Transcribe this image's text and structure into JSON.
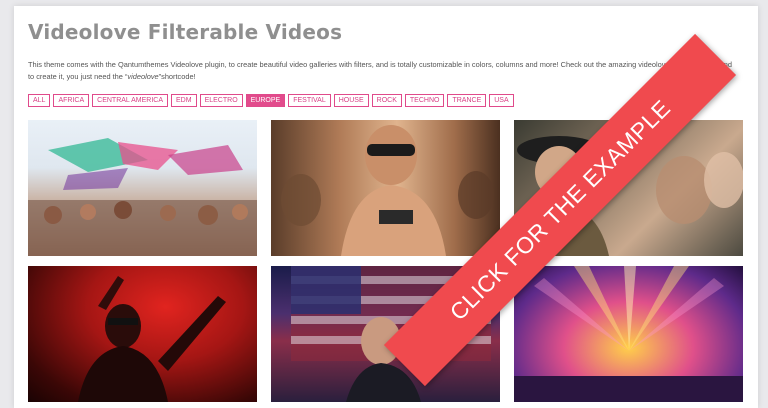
{
  "page": {
    "title": "Videolove Filterable Videos",
    "description_prefix": "This theme comes with the Qantumthemes Videolove plugin, to create beautiful video galleries with filters, and is totally customizable in colors, columns and more! Check out the amazing videolove gallery here… and to create it, you just need the “",
    "description_code": "videolove",
    "description_suffix": "”shortcode!"
  },
  "filters": [
    {
      "label": "ALL",
      "active": false
    },
    {
      "label": "AFRICA",
      "active": false
    },
    {
      "label": "CENTRAL AMERICA",
      "active": false
    },
    {
      "label": "EDM",
      "active": false
    },
    {
      "label": "ELECTRO",
      "active": false
    },
    {
      "label": "EUROPE",
      "active": true
    },
    {
      "label": "FESTIVAL",
      "active": false
    },
    {
      "label": "HOUSE",
      "active": false
    },
    {
      "label": "ROCK",
      "active": false
    },
    {
      "label": "TECHNO",
      "active": false
    },
    {
      "label": "TRANCE",
      "active": false
    },
    {
      "label": "USA",
      "active": false
    }
  ],
  "gallery": [
    {
      "scene": "festival-crowd-with-canopies"
    },
    {
      "scene": "shirtless-man-with-sunglasses"
    },
    {
      "scene": "smiling-woman-in-hat"
    },
    {
      "scene": "performer-under-red-lights"
    },
    {
      "scene": "woman-with-american-flag"
    },
    {
      "scene": "stage-light-show"
    }
  ],
  "ribbon": {
    "label": "CLICK FOR THE EXAMPLE"
  },
  "colors": {
    "accent_pink": "#e24b8c",
    "ribbon_red": "#f04a4e",
    "title_gray": "#8f8f8f"
  }
}
